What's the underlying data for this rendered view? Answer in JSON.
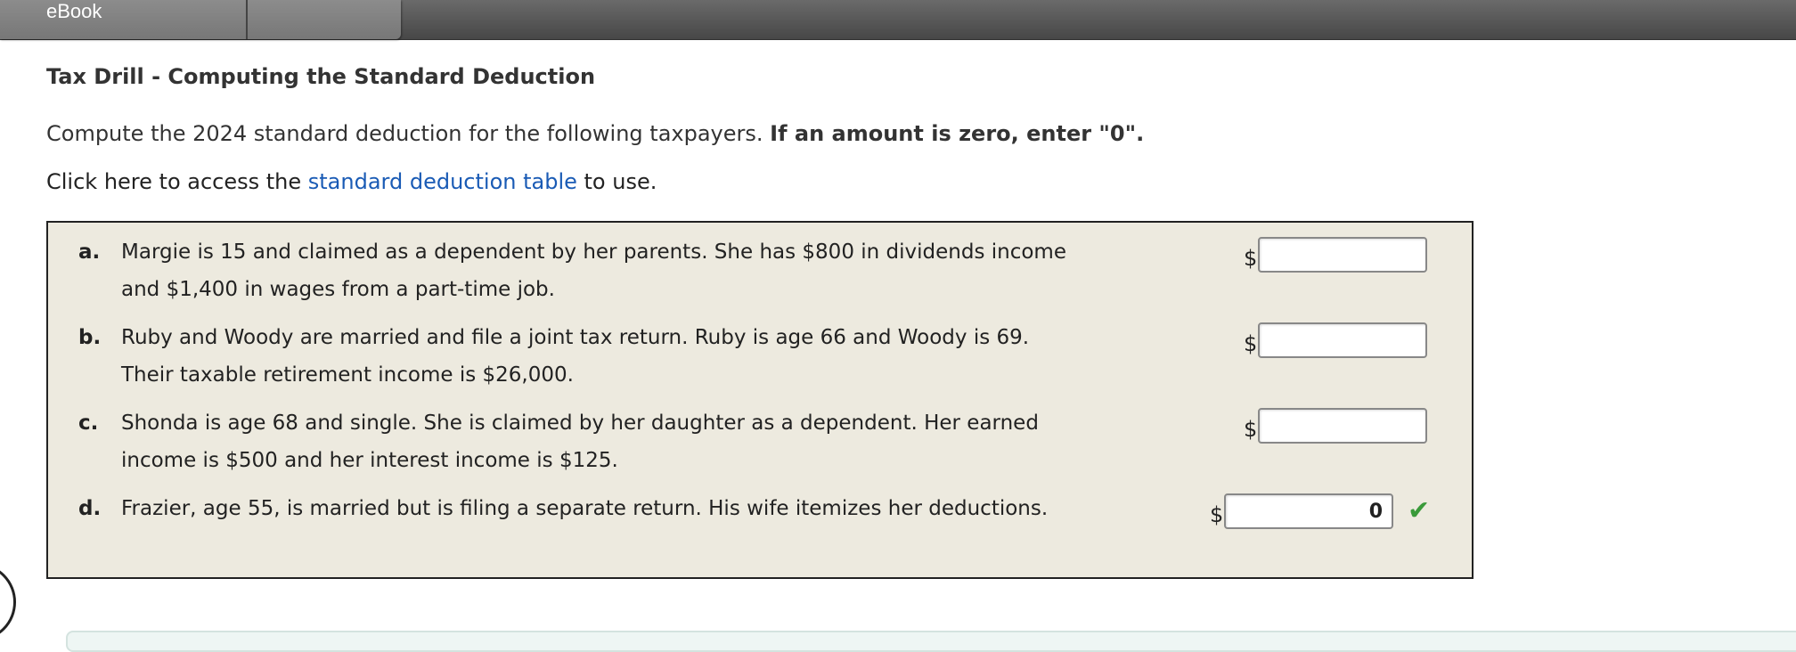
{
  "tab": {
    "label": "eBook"
  },
  "title": "Tax Drill - Computing the Standard Deduction",
  "instructions": {
    "text": "Compute the 2024 standard deduction for the following taxpayers. ",
    "bold": "If an amount is zero, enter \"0\"."
  },
  "access": {
    "prefix": "Click here to access the ",
    "link": "standard deduction table",
    "suffix": " to use."
  },
  "questions": [
    {
      "letter": "a.",
      "line1": "Margie is 15 and claimed as a dependent by her parents. She has $800 in dividends income",
      "line2": "and $1,400 in wages from a part-time job.",
      "currency": "$",
      "value": ""
    },
    {
      "letter": "b.",
      "line1": "Ruby and Woody are married and file a joint tax return. Ruby is age 66 and Woody is 69.",
      "line2": "Their taxable retirement income is $26,000.",
      "currency": "$",
      "value": ""
    },
    {
      "letter": "c.",
      "line1": "Shonda is age 68 and single. She is claimed by her daughter as a dependent. Her earned",
      "line2": "income is $500 and her interest income is $125.",
      "currency": "$",
      "value": ""
    },
    {
      "letter": "d.",
      "line1": "Frazier, age 55, is married but is filing a separate return. His wife itemizes her deductions.",
      "line2": "",
      "currency": "$",
      "value": "0"
    }
  ],
  "status": {
    "d_correct_icon": "checkmark-icon",
    "check_glyph": "✔"
  },
  "colors": {
    "link": "#1a5bb5",
    "panel_bg": "#edeadf",
    "check": "#3a9a3a"
  }
}
